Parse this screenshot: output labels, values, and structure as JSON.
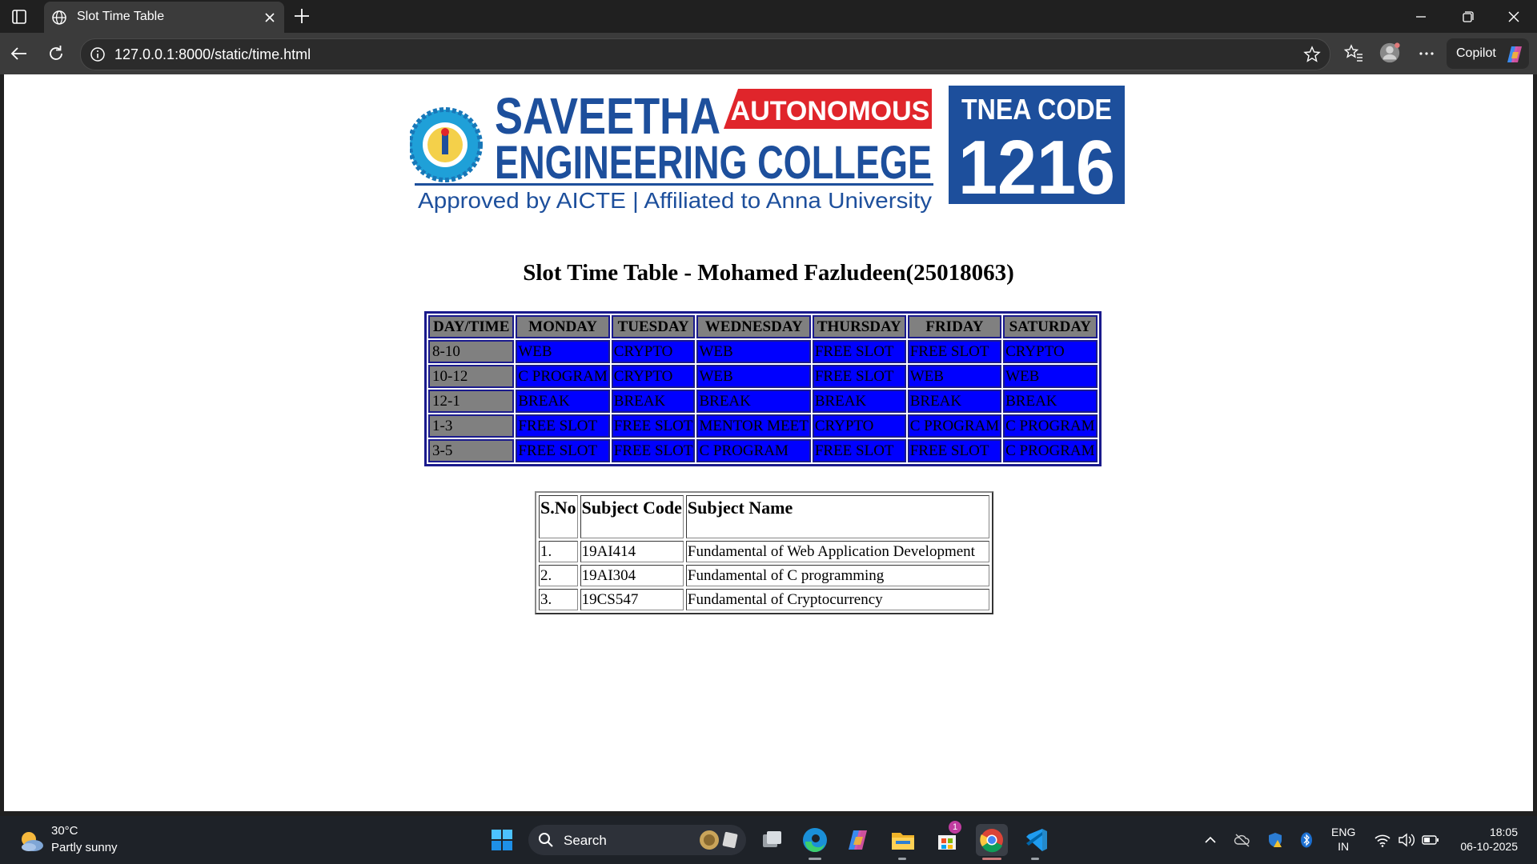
{
  "browser": {
    "tab_title": "Slot Time Table",
    "url": "127.0.0.1:8000/static/time.html",
    "copilot_label": "Copilot"
  },
  "logo": {
    "line1": "SAVEETHA",
    "badge": "AUTONOMOUS",
    "line2": "ENGINEERING COLLEGE",
    "tagline": "Approved by AICTE | Affiliated to Anna University",
    "code_label": "TNEA CODE",
    "code_number": "1216"
  },
  "page": {
    "title": "Slot Time Table - Mohamed Fazludeen(25018063)"
  },
  "timetable": {
    "headers": [
      "DAY/TIME",
      "MONDAY",
      "TUESDAY",
      "WEDNESDAY",
      "THURSDAY",
      "FRIDAY",
      "SATURDAY"
    ],
    "rows": [
      [
        "8-10",
        "WEB",
        "CRYPTO",
        "WEB",
        "FREE SLOT",
        "FREE SLOT",
        "CRYPTO"
      ],
      [
        "10-12",
        "C PROGRAM",
        "CRYPTO",
        "WEB",
        "FREE SLOT",
        "WEB",
        "WEB"
      ],
      [
        "12-1",
        "BREAK",
        "BREAK",
        "BREAK",
        "BREAK",
        "BREAK",
        "BREAK"
      ],
      [
        "1-3",
        "FREE SLOT",
        "FREE SLOT",
        "MENTOR MEET",
        "CRYPTO",
        "C PROGRAM",
        "C PROGRAM"
      ],
      [
        "3-5",
        "FREE SLOT",
        "FREE SLOT",
        "C PROGRAM",
        "FREE SLOT",
        "FREE SLOT",
        "C PROGRAM"
      ]
    ]
  },
  "subjects": {
    "headers": [
      "S.No",
      "Subject Code",
      "Subject Name"
    ],
    "rows": [
      [
        "1.",
        "19AI414",
        "Fundamental of Web Application Development"
      ],
      [
        "2.",
        "19AI304",
        "Fundamental of C programming"
      ],
      [
        "3.",
        "19CS547",
        "Fundamental of Cryptocurrency"
      ]
    ]
  },
  "taskbar": {
    "weather_temp": "30°C",
    "weather_desc": "Partly sunny",
    "search_label": "Search",
    "store_badge": "1",
    "lang_line1": "ENG",
    "lang_line2": "IN",
    "time": "18:05",
    "date": "06-10-2025"
  },
  "colors": {
    "cell_blue": "#0000ff",
    "header_gray": "#808080",
    "border_navy": "#1a1a8c",
    "logo_blue": "#1d4f9c",
    "logo_red": "#e0252b"
  }
}
